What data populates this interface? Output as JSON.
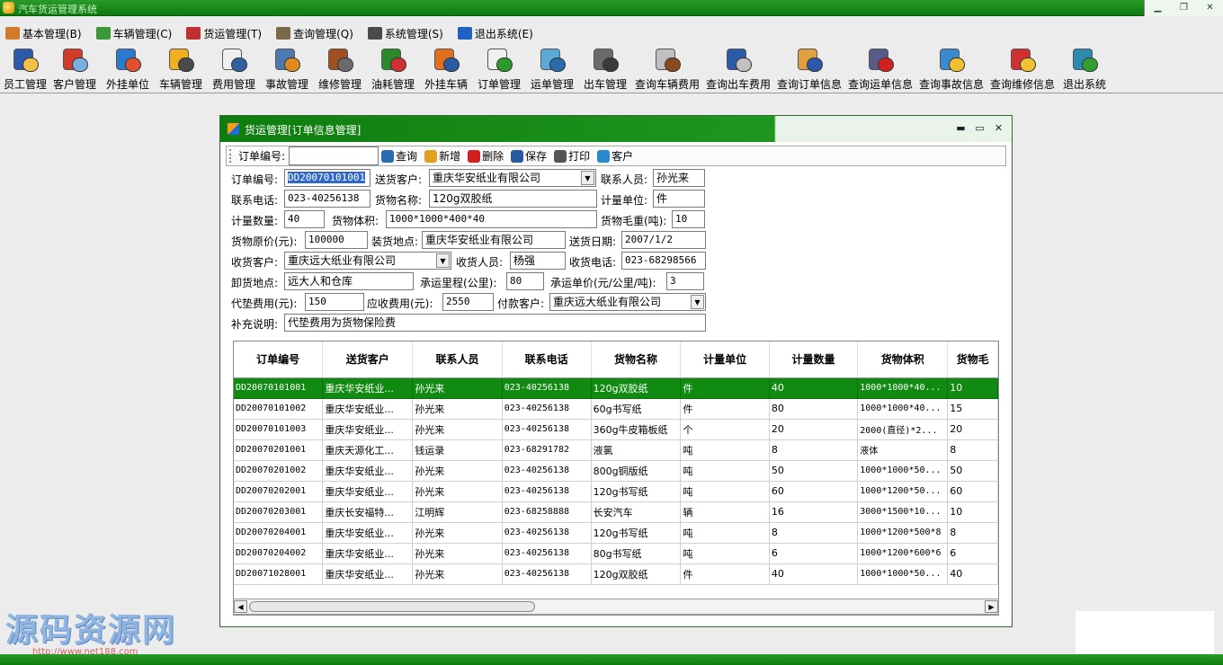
{
  "window": {
    "title": "汽车货运管理系统"
  },
  "menu": [
    {
      "label": "基本管理(B)",
      "icon": "people-icon",
      "color": "#d07a2c"
    },
    {
      "label": "车辆管理(C)",
      "icon": "car-icon",
      "color": "#3a9a3a"
    },
    {
      "label": "货运管理(T)",
      "icon": "tools-icon",
      "color": "#c03030"
    },
    {
      "label": "查询管理(Q)",
      "icon": "query-icon",
      "color": "#7a6a4a"
    },
    {
      "label": "系统管理(S)",
      "icon": "system-icon",
      "color": "#4a4a4a"
    },
    {
      "label": "退出系统(E)",
      "icon": "exit-icon",
      "color": "#2060c0"
    }
  ],
  "toolbar": [
    {
      "label": "员工管理",
      "icon": "employee-icon",
      "c1": "#2c5aa8",
      "c2": "#f2c04a"
    },
    {
      "label": "客户管理",
      "icon": "customer-icon",
      "c1": "#d23a2a",
      "c2": "#7ab0e0"
    },
    {
      "label": "外挂单位",
      "icon": "house-icon",
      "c1": "#2c7ad0",
      "c2": "#e05030"
    },
    {
      "label": "车辆管理",
      "icon": "truck-icon",
      "c1": "#f0b020",
      "c2": "#4a4a4a"
    },
    {
      "label": "费用管理",
      "icon": "pen-note-icon",
      "c1": "#f0f0f0",
      "c2": "#3060a0"
    },
    {
      "label": "事故管理",
      "icon": "accident-icon",
      "c1": "#4a7ab0",
      "c2": "#e08a20"
    },
    {
      "label": "维修管理",
      "icon": "wrench-icon",
      "c1": "#a05020",
      "c2": "#6a6a6a"
    },
    {
      "label": "油耗管理",
      "icon": "fuel-icon",
      "c1": "#2a8a2a",
      "c2": "#d03030"
    },
    {
      "label": "外挂车辆",
      "icon": "van-icon",
      "c1": "#e07020",
      "c2": "#2a5aa0"
    },
    {
      "label": "订单管理",
      "icon": "order-icon",
      "c1": "#f0f0f0",
      "c2": "#2a9a2a"
    },
    {
      "label": "运单管理",
      "icon": "waybill-icon",
      "c1": "#5aaad8",
      "c2": "#2a6aa8"
    },
    {
      "label": "出车管理",
      "icon": "gear-car-icon",
      "c1": "#6a6a6a",
      "c2": "#3a3a3a"
    },
    {
      "label": "查询车辆费用",
      "icon": "magnifier-icon",
      "c1": "#c0c0c0",
      "c2": "#8a4a20"
    },
    {
      "label": "查询出车费用",
      "icon": "magnifier-person-icon",
      "c1": "#2a5aa8",
      "c2": "#c0c0c0"
    },
    {
      "label": "查询订单信息",
      "icon": "magnifier-doc-icon",
      "c1": "#e0a040",
      "c2": "#2a5aa8"
    },
    {
      "label": "查询运单信息",
      "icon": "disk-icon",
      "c1": "#5a5a8a",
      "c2": "#d02020"
    },
    {
      "label": "查询事故信息",
      "icon": "globe-icon",
      "c1": "#3a8ad0",
      "c2": "#f0c030"
    },
    {
      "label": "查询维修信息",
      "icon": "books-icon",
      "c1": "#d03030",
      "c2": "#f0c030"
    },
    {
      "label": "退出系统",
      "icon": "exit-door-icon",
      "c1": "#2a8ab0",
      "c2": "#30a030"
    }
  ],
  "child": {
    "title": "货运管理[订单信息管理]",
    "toolbar": {
      "order_no_label": "订单编号:",
      "order_no_value": "",
      "buttons": [
        {
          "label": "查询",
          "icon": "search-icon"
        },
        {
          "label": "新增",
          "icon": "add-icon"
        },
        {
          "label": "删除",
          "icon": "delete-icon"
        },
        {
          "label": "保存",
          "icon": "save-icon"
        },
        {
          "label": "打印",
          "icon": "print-icon"
        },
        {
          "label": "客户",
          "icon": "customer-icon"
        }
      ]
    },
    "form": {
      "order_no": {
        "label": "订单编号:",
        "value": "DD20070101001"
      },
      "sender": {
        "label": "送货客户:",
        "value": "重庆华安纸业有限公司"
      },
      "contact": {
        "label": "联系人员:",
        "value": "孙光来"
      },
      "phone": {
        "label": "联系电话:",
        "value": "023-40256138"
      },
      "goods_name": {
        "label": "货物名称:",
        "value": "120g双胶纸"
      },
      "unit": {
        "label": "计量单位:",
        "value": "件"
      },
      "qty": {
        "label": "计量数量:",
        "value": "40"
      },
      "volume": {
        "label": "货物体积:",
        "value": "1000*1000*400*40"
      },
      "weight": {
        "label": "货物毛重(吨):",
        "value": "10"
      },
      "price": {
        "label": "货物原价(元):",
        "value": "100000"
      },
      "load_place": {
        "label": "装货地点:",
        "value": "重庆华安纸业有限公司"
      },
      "send_date": {
        "label": "送货日期:",
        "value": "2007/1/2"
      },
      "receiver": {
        "label": "收货客户:",
        "value": "重庆远大纸业有限公司"
      },
      "recv_person": {
        "label": "收货人员:",
        "value": "杨强"
      },
      "recv_phone": {
        "label": "收货电话:",
        "value": "023-68298566"
      },
      "unload_place": {
        "label": "卸货地点:",
        "value": "远大人和仓库"
      },
      "distance": {
        "label": "承运里程(公里):",
        "value": "80"
      },
      "unit_price": {
        "label": "承运单价(元/公里/吨):",
        "value": "3"
      },
      "advance_fee": {
        "label": "代垫费用(元):",
        "value": "150"
      },
      "receivable_fee": {
        "label": "应收费用(元):",
        "value": "2550"
      },
      "payer": {
        "label": "付款客户:",
        "value": "重庆远大纸业有限公司"
      },
      "remark": {
        "label": "补充说明:",
        "value": "代垫费用为货物保险费"
      }
    },
    "grid": {
      "columns": [
        "订单编号",
        "送货客户",
        "联系人员",
        "联系电话",
        "货物名称",
        "计量单位",
        "计量数量",
        "货物体积",
        "货物毛"
      ],
      "rows": [
        [
          "DD20070101001",
          "重庆华安纸业...",
          "孙光来",
          "023-40256138",
          "120g双胶纸",
          "件",
          "40",
          "1000*1000*40...",
          "10"
        ],
        [
          "DD20070101002",
          "重庆华安纸业...",
          "孙光来",
          "023-40256138",
          "60g书写纸",
          "件",
          "80",
          "1000*1000*40...",
          "15"
        ],
        [
          "DD20070101003",
          "重庆华安纸业...",
          "孙光来",
          "023-40256138",
          "360g牛皮箱板纸",
          "个",
          "20",
          "2000(直径)*2...",
          "20"
        ],
        [
          "DD20070201001",
          "重庆天源化工...",
          "钱运录",
          "023-68291782",
          "液氯",
          "吨",
          "8",
          "液体",
          "8"
        ],
        [
          "DD20070201002",
          "重庆华安纸业...",
          "孙光来",
          "023-40256138",
          "800g铜版纸",
          "吨",
          "50",
          "1000*1000*50...",
          "50"
        ],
        [
          "DD20070202001",
          "重庆华安纸业...",
          "孙光来",
          "023-40256138",
          "120g书写纸",
          "吨",
          "60",
          "1000*1200*50...",
          "60"
        ],
        [
          "DD20070203001",
          "重庆长安福特...",
          "江明辉",
          "023-68258888",
          "长安汽车",
          "辆",
          "16",
          "3000*1500*10...",
          "10"
        ],
        [
          "DD20070204001",
          "重庆华安纸业...",
          "孙光来",
          "023-40256138",
          "120g书写纸",
          "吨",
          "8",
          "1000*1200*500*8",
          "8"
        ],
        [
          "DD20070204002",
          "重庆华安纸业...",
          "孙光来",
          "023-40256138",
          "80g书写纸",
          "吨",
          "6",
          "1000*1200*600*6",
          "6"
        ],
        [
          "DD20071028001",
          "重庆华安纸业...",
          "孙光来",
          "023-40256138",
          "120g双胶纸",
          "件",
          "40",
          "1000*1000*50...",
          "40"
        ]
      ],
      "selected_row": 0
    }
  },
  "watermark": {
    "main": "源码资源网",
    "url": "http://www.net188.com"
  }
}
